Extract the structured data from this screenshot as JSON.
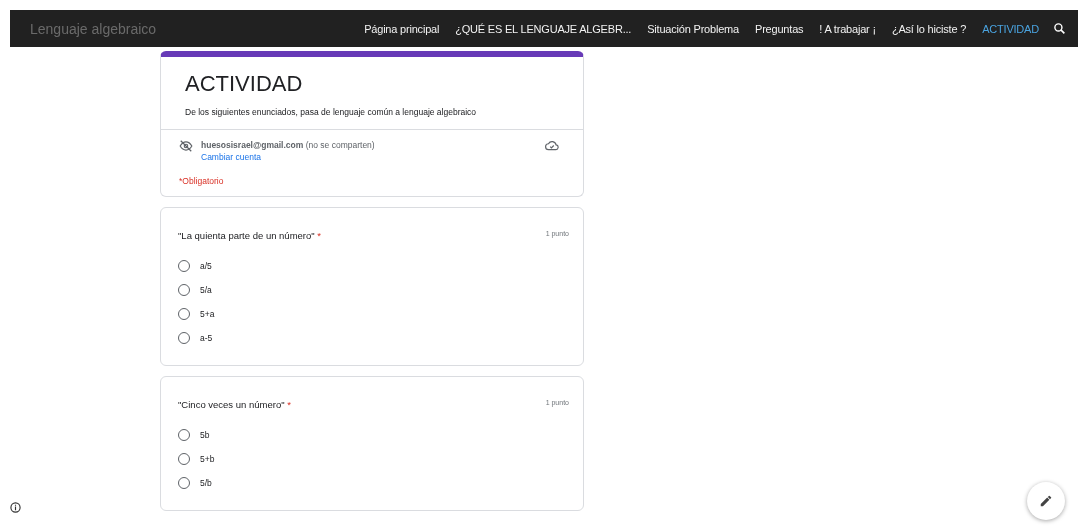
{
  "site_title": "Lenguaje algebraico",
  "nav": [
    {
      "label": "Página principal",
      "selected": false
    },
    {
      "label": "¿QUÉ ES EL LENGUAJE ALGEBR...",
      "selected": false
    },
    {
      "label": "Situación Problema",
      "selected": false
    },
    {
      "label": "Preguntas",
      "selected": false
    },
    {
      "label": "! A trabajar ¡",
      "selected": false
    },
    {
      "label": "¿Así lo hiciste ?",
      "selected": false
    },
    {
      "label": "ACTIVIDAD",
      "selected": true
    }
  ],
  "form": {
    "title": "ACTIVIDAD",
    "description": "De los siguientes enunciados, pasa de lenguaje común a lenguaje algebraico",
    "email": "huesosisrael@gmail.com",
    "email_note": "(no se comparten)",
    "switch_account": "Cambiar cuenta",
    "required_note": "*Obligatorio"
  },
  "questions": [
    {
      "text": "\"La quienta parte de un número\"",
      "required_mark": "*",
      "points": "1 punto",
      "options": [
        {
          "label": "a/5",
          "selected": false
        },
        {
          "label": "5/a",
          "selected": false
        },
        {
          "label": "5+a",
          "selected": false
        },
        {
          "label": "a-5",
          "selected": false
        }
      ]
    },
    {
      "text": "\"Cinco veces un número\"",
      "required_mark": "*",
      "points": "1 punto",
      "options": [
        {
          "label": "5b",
          "selected": false
        },
        {
          "label": "5+b",
          "selected": false
        },
        {
          "label": "5/b",
          "selected": false
        }
      ]
    }
  ]
}
